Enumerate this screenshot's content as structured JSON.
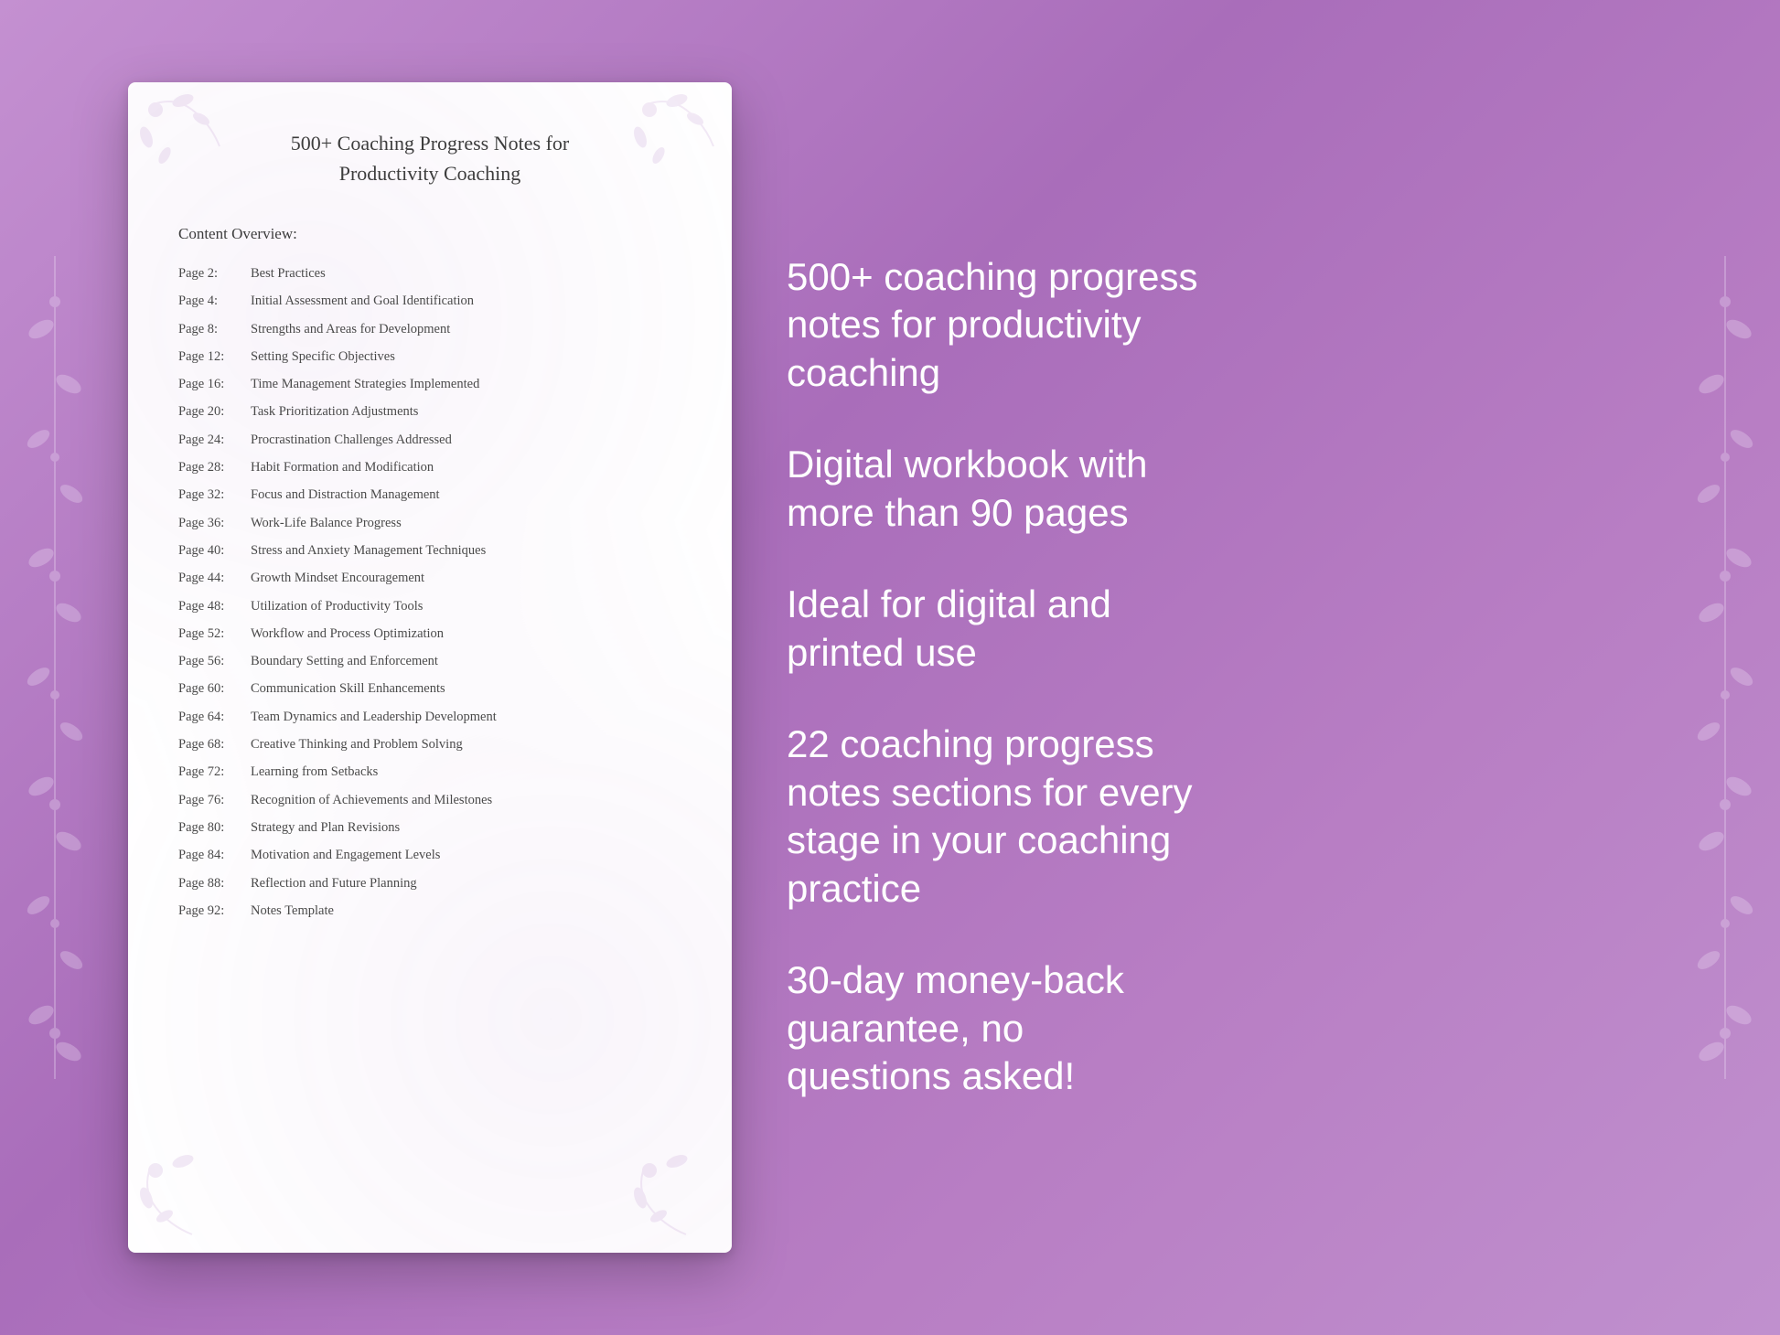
{
  "background": {
    "color": "#b47fc0"
  },
  "document": {
    "title_line1": "500+ Coaching Progress Notes for",
    "title_line2": "Productivity Coaching",
    "section_title": "Content Overview:",
    "toc_items": [
      {
        "page": "Page  2:",
        "text": "Best Practices"
      },
      {
        "page": "Page  4:",
        "text": "Initial Assessment and Goal Identification"
      },
      {
        "page": "Page  8:",
        "text": "Strengths and Areas for Development"
      },
      {
        "page": "Page 12:",
        "text": "Setting Specific Objectives"
      },
      {
        "page": "Page 16:",
        "text": "Time Management Strategies Implemented"
      },
      {
        "page": "Page 20:",
        "text": "Task Prioritization Adjustments"
      },
      {
        "page": "Page 24:",
        "text": "Procrastination Challenges Addressed"
      },
      {
        "page": "Page 28:",
        "text": "Habit Formation and Modification"
      },
      {
        "page": "Page 32:",
        "text": "Focus and Distraction Management"
      },
      {
        "page": "Page 36:",
        "text": "Work-Life Balance Progress"
      },
      {
        "page": "Page 40:",
        "text": "Stress and Anxiety Management Techniques"
      },
      {
        "page": "Page 44:",
        "text": "Growth Mindset Encouragement"
      },
      {
        "page": "Page 48:",
        "text": "Utilization of Productivity Tools"
      },
      {
        "page": "Page 52:",
        "text": "Workflow and Process Optimization"
      },
      {
        "page": "Page 56:",
        "text": "Boundary Setting and Enforcement"
      },
      {
        "page": "Page 60:",
        "text": "Communication Skill Enhancements"
      },
      {
        "page": "Page 64:",
        "text": "Team Dynamics and Leadership Development"
      },
      {
        "page": "Page 68:",
        "text": "Creative Thinking and Problem Solving"
      },
      {
        "page": "Page 72:",
        "text": "Learning from Setbacks"
      },
      {
        "page": "Page 76:",
        "text": "Recognition of Achievements and Milestones"
      },
      {
        "page": "Page 80:",
        "text": "Strategy and Plan Revisions"
      },
      {
        "page": "Page 84:",
        "text": "Motivation and Engagement Levels"
      },
      {
        "page": "Page 88:",
        "text": "Reflection and Future Planning"
      },
      {
        "page": "Page 92:",
        "text": "Notes Template"
      }
    ]
  },
  "features": [
    "500+ coaching progress\nnotes for productivity\ncoaching",
    "Digital workbook with\nmore than 90 pages",
    "Ideal for digital and\nprinted use",
    "22 coaching progress\nnotes sections for every\nstage in your coaching\npractice",
    "30-day money-back\nguarantee, no\nquestions asked!"
  ]
}
